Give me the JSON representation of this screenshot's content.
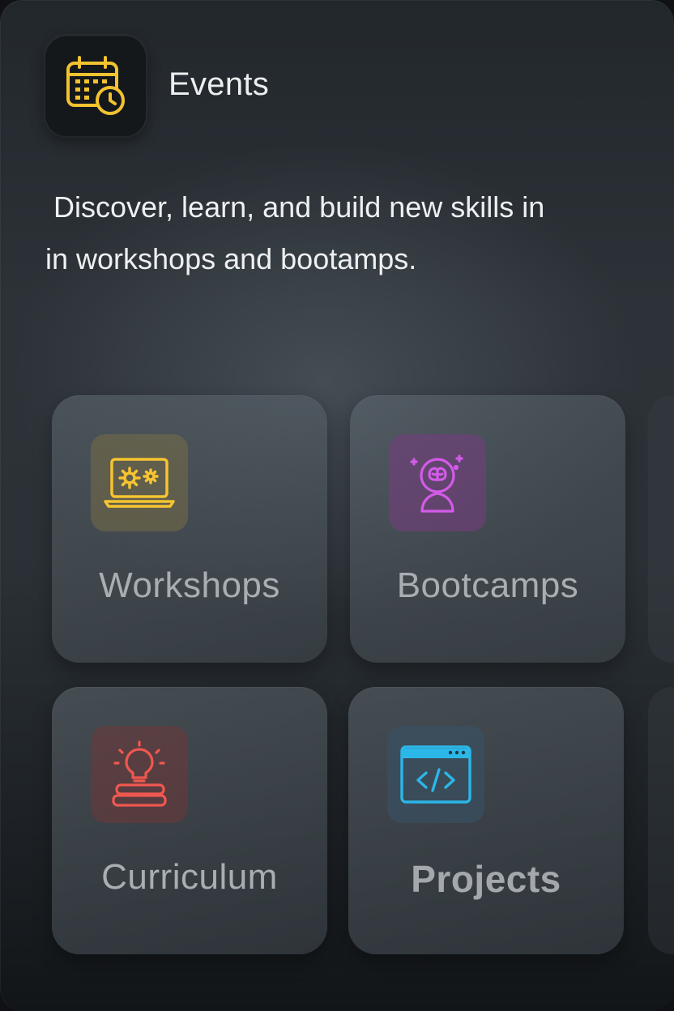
{
  "header": {
    "title": "Events",
    "icon": "calendar-clock-icon",
    "icon_color": "#F2C230"
  },
  "description": " Discover, learn, and build new skills in\nin workshops and bootamps.",
  "tiles": [
    {
      "label": "Workshops",
      "icon": "laptop-gears-icon",
      "color": "#F5C431"
    },
    {
      "label": "Bootcamps",
      "icon": "brain-head-icon",
      "color": "#D35BE8"
    },
    {
      "label": "Curriculum",
      "icon": "lightbulb-books-icon",
      "color": "#F0574F"
    },
    {
      "label": "Projects",
      "icon": "browser-code-icon",
      "color": "#2BB7E8"
    }
  ]
}
